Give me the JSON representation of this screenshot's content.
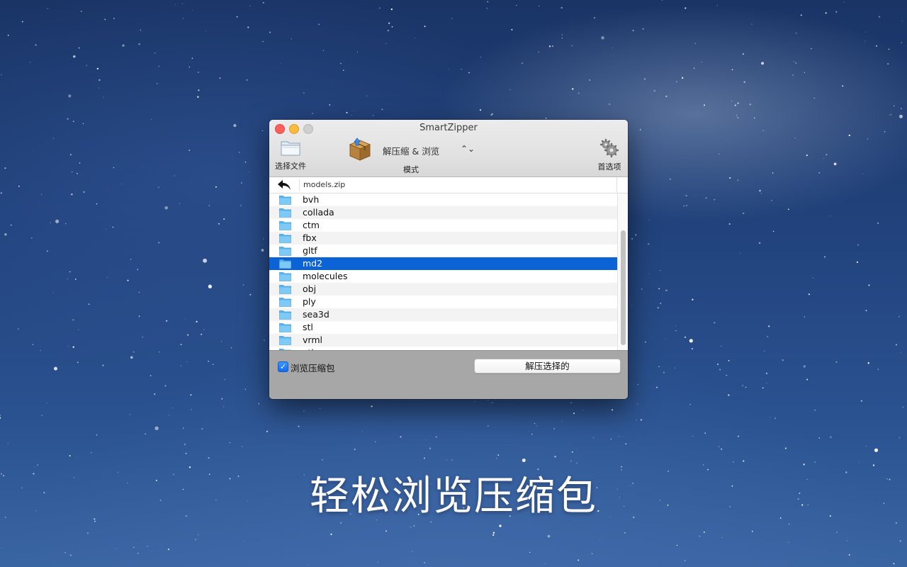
{
  "desktop": {
    "caption": "轻松浏览压缩包"
  },
  "window": {
    "title": "SmartZipper"
  },
  "toolbar": {
    "open_file_label": "选择文件",
    "mode_value": "解压缩 & 浏览",
    "mode_label": "模式",
    "prefs_label": "首选项"
  },
  "pathbar": {
    "current_path": "models.zip"
  },
  "files": [
    {
      "name": "bvh",
      "icon": "folder-icon"
    },
    {
      "name": "collada",
      "icon": "folder-icon"
    },
    {
      "name": "ctm",
      "icon": "folder-icon"
    },
    {
      "name": "fbx",
      "icon": "folder-icon"
    },
    {
      "name": "gltf",
      "icon": "folder-icon"
    },
    {
      "name": "md2",
      "icon": "folder-icon",
      "selected": true
    },
    {
      "name": "molecules",
      "icon": "folder-icon"
    },
    {
      "name": "obj",
      "icon": "folder-icon"
    },
    {
      "name": "ply",
      "icon": "folder-icon"
    },
    {
      "name": "sea3d",
      "icon": "folder-icon"
    },
    {
      "name": "stl",
      "icon": "folder-icon"
    },
    {
      "name": "vrml",
      "icon": "folder-icon"
    },
    {
      "name": "vtk",
      "icon": "folder-icon"
    }
  ],
  "bottom": {
    "browse_checkbox_label": "浏览压缩包",
    "browse_checked": true,
    "extract_button_label": "解压选择的"
  },
  "colors": {
    "selection": "#0c63d6",
    "folder": "#6ec2f3",
    "close": "#fc605b",
    "minimize": "#fdbc40"
  }
}
